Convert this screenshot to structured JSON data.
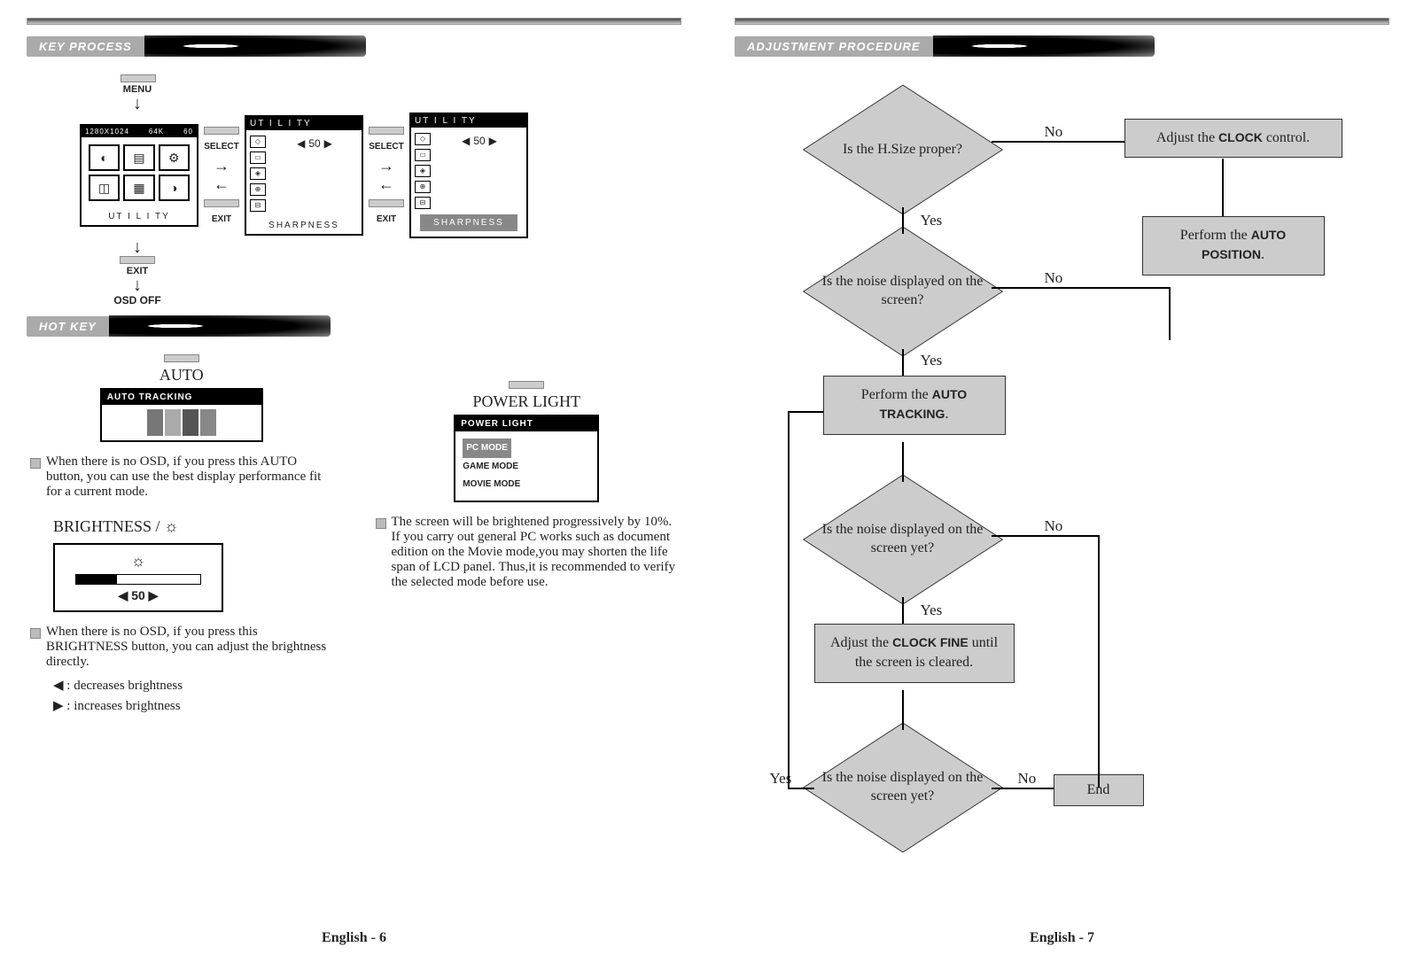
{
  "left": {
    "section1": "KEY PROCESS",
    "menu": "MENU",
    "main_osd": {
      "resolution": "1280X1024",
      "khz": "64K",
      "hz": "60",
      "footer": "UT I L I TY"
    },
    "select": "SELECT",
    "exit": "EXIT",
    "util1": {
      "title": "UT I L I TY",
      "value": "50",
      "footer": "SHARPNESS"
    },
    "util2": {
      "title": "UT I L I TY",
      "value": "50",
      "footer": "SHARPNESS"
    },
    "osd_off": "OSD OFF",
    "section2": "HOT KEY",
    "auto": {
      "btn": "AUTO",
      "bar": "AUTO TRACKING"
    },
    "auto_desc": "When there is no OSD, if you press this AUTO button, you can use the best display performance fit  for a current mode.",
    "bright_title": "BRIGHTNESS / ",
    "bright_val": "50",
    "bright_desc": "When there is no OSD, if you press this BRIGHTNESS button, you can adjust the brightness directly.",
    "dec": ":  decreases brightness",
    "inc": ":  increases brightness",
    "pl": {
      "btn": "POWER LIGHT",
      "bar": "POWER LIGHT",
      "m1": "PC MODE",
      "m2": "GAME MODE",
      "m3": "MOVIE MODE"
    },
    "pl_desc": "The screen will be brightened progressively by 10%. If you carry out general PC works such as document edition on the Movie mode,you may shorten the life span of LCD panel. Thus,it is recommended to verify the selected mode before use.",
    "page": "English - 6"
  },
  "right": {
    "section": "ADJUSTMENT PROCEDURE",
    "d1": "Is the H.Size proper?",
    "d2": "Is the noise displayed on the screen?",
    "d3": "Is the noise displayed on the screen yet?",
    "d4": "Is the noise displayed on the screen yet?",
    "b1a": "Adjust the ",
    "b1b": "CLOCK",
    "b1c": " control.",
    "b2a": "Perform the ",
    "b2b": "AUTO POSITION",
    "b2c": ".",
    "b3a": "Perform the ",
    "b3b": "AUTO TRACKING",
    "b3c": ".",
    "b4a": "Adjust the ",
    "b4b": "CLOCK FINE",
    "b4c": " until the screen is cleared.",
    "end": "End",
    "yes": "Yes",
    "no": "No",
    "page": "English - 7"
  }
}
